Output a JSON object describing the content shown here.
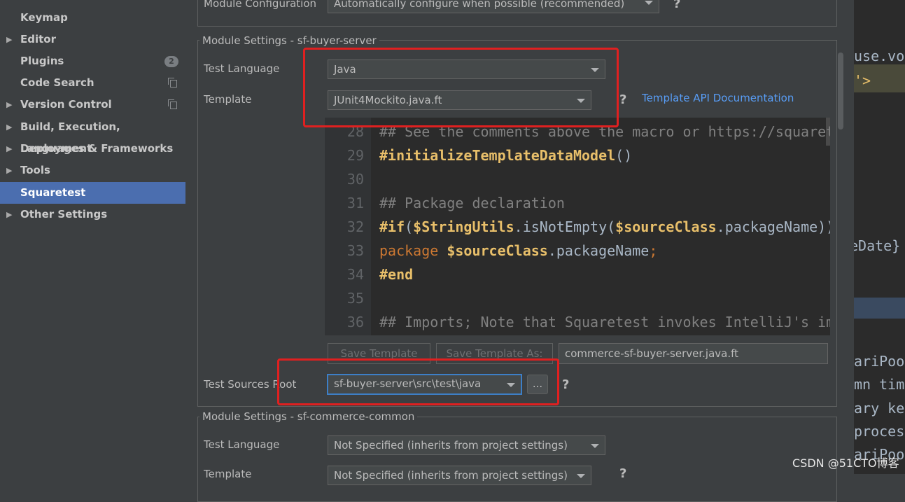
{
  "sidebar": {
    "items": [
      {
        "label": "Keymap",
        "arrow": false,
        "badge": "",
        "copy": false
      },
      {
        "label": "Editor",
        "arrow": true,
        "badge": "",
        "copy": false
      },
      {
        "label": "Plugins",
        "arrow": false,
        "badge": "2",
        "copy": false
      },
      {
        "label": "Code Search",
        "arrow": false,
        "badge": "",
        "copy": true
      },
      {
        "label": "Version Control",
        "arrow": true,
        "badge": "",
        "copy": true
      },
      {
        "label": "Build, Execution, Deployment",
        "arrow": true,
        "badge": "",
        "copy": false
      },
      {
        "label": "Languages & Frameworks",
        "arrow": true,
        "badge": "",
        "copy": false
      },
      {
        "label": "Tools",
        "arrow": true,
        "badge": "",
        "copy": false
      },
      {
        "label": "Squaretest",
        "arrow": false,
        "badge": "",
        "copy": false,
        "selected": true
      },
      {
        "label": "Other Settings",
        "arrow": true,
        "badge": "",
        "copy": false
      }
    ]
  },
  "top_section": {
    "module_configuration_label": "Module Configuration",
    "module_configuration_value": "Automatically configure when possible (recommended)",
    "help": "?"
  },
  "module1": {
    "title": "Module Settings - sf-buyer-server",
    "test_language_label": "Test Language",
    "test_language_value": "Java",
    "template_label": "Template",
    "template_value": "JUnit4Mockito.java.ft",
    "template_help": "?",
    "template_api_link": "Template API Documentation",
    "code_lines": [
      {
        "num": "28",
        "parts": [
          {
            "t": "## See the comments above the macro or https://squaretest.com",
            "c": "cmt"
          }
        ]
      },
      {
        "num": "29",
        "parts": [
          {
            "t": "#initializeTemplateDataModel",
            "c": "dir"
          },
          {
            "t": "()",
            "c": "plain"
          }
        ]
      },
      {
        "num": "30",
        "parts": []
      },
      {
        "num": "31",
        "parts": [
          {
            "t": "## Package declaration",
            "c": "cmt"
          }
        ]
      },
      {
        "num": "32",
        "parts": [
          {
            "t": "#if",
            "c": "dir"
          },
          {
            "t": "(",
            "c": "plain"
          },
          {
            "t": "$StringUtils",
            "c": "dir"
          },
          {
            "t": ".isNotEmpty(",
            "c": "plain"
          },
          {
            "t": "$sourceClass",
            "c": "dir"
          },
          {
            "t": ".packageName))",
            "c": "plain"
          }
        ]
      },
      {
        "num": "33",
        "parts": [
          {
            "t": "package ",
            "c": "kw"
          },
          {
            "t": "$sourceClass",
            "c": "dir"
          },
          {
            "t": ".packageName",
            "c": "plain"
          },
          {
            "t": ";",
            "c": "kw"
          }
        ]
      },
      {
        "num": "34",
        "parts": [
          {
            "t": "#end",
            "c": "dir"
          }
        ]
      },
      {
        "num": "35",
        "parts": []
      },
      {
        "num": "36",
        "parts": [
          {
            "t": "## Imports; Note that Squaretest invokes IntelliJ's import optimizer",
            "c": "cmt"
          }
        ]
      }
    ],
    "save_template_label": "Save Template",
    "save_template_as_label": "Save Template As:",
    "save_as_filename": "commerce-sf-buyer-server.java.ft",
    "test_sources_root_label": "Test Sources Root",
    "test_sources_root_value": "sf-buyer-server\\src\\test\\java",
    "browse_label": "...",
    "test_sources_help": "?"
  },
  "module2": {
    "title": "Module Settings - sf-commerce-common",
    "test_language_label": "Test Language",
    "test_language_value": "Not Specified (inherits from project settings)",
    "template_label": "Template",
    "template_value": "Not Specified (inherits from project settings)",
    "template_help": "?"
  },
  "right_background_text": [
    "use.vo.",
    "'>",
    "eDate}",
    "ariPoo",
    "mn tim",
    "ary ke",
    "proces",
    "ariPoo"
  ],
  "watermark": "CSDN @51CTO博客",
  "colors": {
    "background": "#3c3f41",
    "selection": "#4b6eaf",
    "link": "#589df6",
    "highlight_box": "#e02020",
    "focus": "#3d7fc7"
  }
}
